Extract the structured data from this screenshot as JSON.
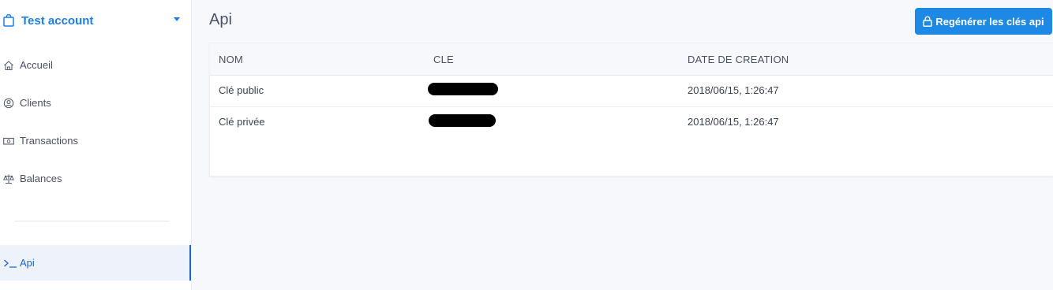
{
  "sidebar": {
    "account_name": "Test account",
    "items": [
      {
        "label": "Accueil",
        "icon": "home-icon"
      },
      {
        "label": "Clients",
        "icon": "user-circle-icon"
      },
      {
        "label": "Transactions",
        "icon": "money-bill-icon"
      },
      {
        "label": "Balances",
        "icon": "balance-scale-icon"
      }
    ],
    "active_item": {
      "label": "Api",
      "icon": "terminal-icon"
    }
  },
  "main": {
    "title": "Api",
    "regenerate_label": "Regénérer les clés api",
    "table": {
      "headers": [
        "NOM",
        "CLE",
        "DATE DE CREATION"
      ],
      "rows": [
        {
          "nom": "Clé public",
          "cle": "[redacted]",
          "date": "2018/06/15, 1:26:47"
        },
        {
          "nom": "Clé privée",
          "cle": "[redacted]",
          "date": "2018/06/15, 1:26:47"
        }
      ]
    }
  },
  "colors": {
    "accent": "#1e88e5",
    "active": "#1f65c8",
    "background": "#f7f8fb"
  }
}
